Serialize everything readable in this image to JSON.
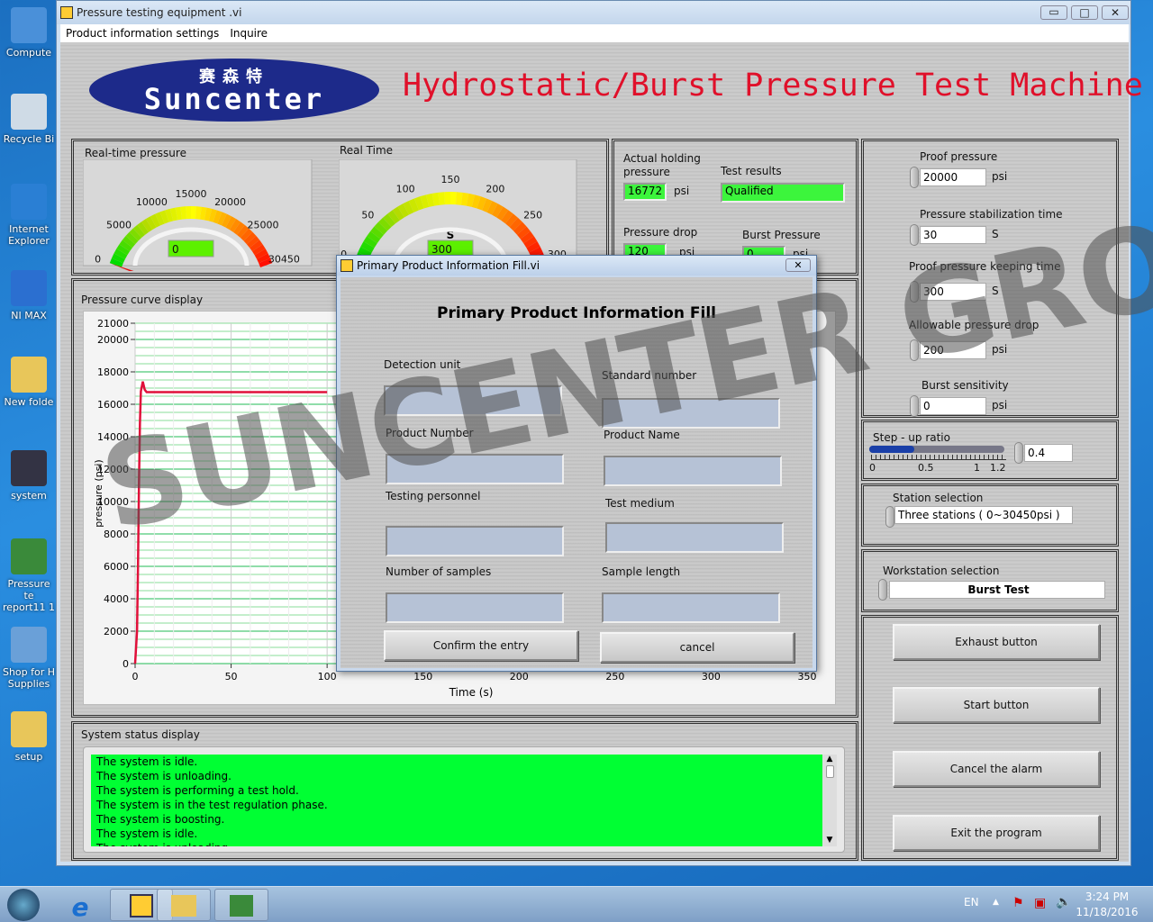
{
  "desktop": {
    "icons": [
      {
        "label": "Compute",
        "icon": "computer-icon",
        "color": "#4a90d9"
      },
      {
        "label": "Recycle Bi",
        "icon": "recycle-bin-icon",
        "color": "#cfdbe6"
      },
      {
        "label": "Internet Explorer",
        "icon": "internet-explorer-icon",
        "color": "#2a7fd4"
      },
      {
        "label": "NI MAX",
        "icon": "ni-max-icon",
        "color": "#2b6fd0"
      },
      {
        "label": "New folde",
        "icon": "folder-icon",
        "color": "#e8c65a"
      },
      {
        "label": "system",
        "icon": "labview-vi-icon",
        "color": "#334"
      },
      {
        "label": "Pressure te report11 1",
        "icon": "excel-file-icon",
        "color": "#3a8a3a"
      },
      {
        "label": "Shop for H Supplies",
        "icon": "printer-icon",
        "color": "#6aa0d8"
      },
      {
        "label": "setup",
        "icon": "folder-icon",
        "color": "#e8c65a"
      }
    ]
  },
  "window": {
    "title": "Pressure testing equipment .vi",
    "menu": [
      "Product information settings",
      "Inquire"
    ]
  },
  "header": {
    "logo_cn": "赛森特",
    "logo_en": "Suncenter",
    "title": "Hydrostatic/Burst Pressure Test Machine",
    "title_color": "#e0102a",
    "logo_color": "#1d2a8a"
  },
  "gauges": {
    "pressure": {
      "label": "Real-time pressure",
      "unit": "psi",
      "ticks": [
        "0",
        "5000",
        "10000",
        "15000",
        "20000",
        "25000",
        "30450"
      ],
      "value": "0",
      "max": 30450
    },
    "time": {
      "label": "Real Time",
      "unit": "S",
      "ticks": [
        "0",
        "50",
        "100",
        "150",
        "200",
        "250",
        "300"
      ],
      "value": "300",
      "max": 300
    }
  },
  "results": {
    "holding_label": "Actual holding pressure",
    "holding_value": "16772",
    "holding_unit": "psi",
    "test_results_label": "Test results",
    "test_results_value": "Qualified",
    "drop_label": "Pressure drop",
    "drop_value": "120",
    "drop_unit": "psi",
    "burst_label": "Burst Pressure",
    "burst_value": "0",
    "burst_unit": "psi"
  },
  "chart_data": {
    "type": "line",
    "title": "Pressure curve display",
    "xlabel": "Time (s)",
    "ylabel": "pressure (psi)",
    "xlim": [
      0,
      350
    ],
    "ylim": [
      0,
      21000
    ],
    "x_ticks": [
      "0",
      "50",
      "100",
      "150",
      "200",
      "250",
      "300",
      "350"
    ],
    "y_ticks": [
      "0",
      "2000",
      "4000",
      "6000",
      "8000",
      "10000",
      "12000",
      "14000",
      "16000",
      "18000",
      "20000",
      "21000"
    ],
    "grid": true,
    "line_color": "#e0103a",
    "x": [
      0,
      1,
      1.5,
      2,
      2.5,
      3,
      4,
      5,
      6,
      50,
      100
    ],
    "y": [
      0,
      2000,
      6000,
      11000,
      14800,
      16800,
      17400,
      16900,
      16750,
      16750,
      16750
    ]
  },
  "settings": {
    "fields": [
      {
        "label": "Proof pressure",
        "value": "20000",
        "unit": "psi"
      },
      {
        "label": "Pressure stabilization time",
        "value": "30",
        "unit": "S"
      },
      {
        "label": "Proof pressure keeping time",
        "value": "300",
        "unit": "S"
      },
      {
        "label": "Allowable pressure drop",
        "value": "200",
        "unit": "psi"
      },
      {
        "label": "Burst sensitivity",
        "value": "0",
        "unit": "psi"
      }
    ],
    "stepup": {
      "label": "Step - up ratio",
      "ticks": [
        "0",
        "0.5",
        "1",
        "1.2"
      ],
      "value": "0.4",
      "fraction": 0.333
    },
    "station": {
      "label": "Station selection",
      "value": "Three stations ( 0~30450psi )"
    },
    "workstation": {
      "label": "Workstation selection",
      "value": "Burst Test"
    },
    "buttons": [
      "Exhaust button",
      "Start  button",
      "Cancel the alarm",
      "Exit the program"
    ]
  },
  "status": {
    "label": "System status display",
    "lines": [
      "The system is idle.",
      "The system is unloading.",
      "The system is performing a test hold.",
      "The system is in the test regulation phase.",
      "The system is boosting.",
      "The system is idle.",
      "The system is unloading."
    ]
  },
  "dialog": {
    "title": "Primary Product Information Fill.vi",
    "heading": "Primary Product Information Fill",
    "fields": [
      "Detection unit",
      "Standard number",
      "Product Number",
      "Product Name",
      "Testing personnel",
      "Test medium",
      "Number of samples",
      "Sample length"
    ],
    "confirm": "Confirm the entry",
    "cancel": "cancel"
  },
  "watermark": "SUNCENTER GROUP",
  "taskbar": {
    "lang": "EN",
    "time": "3:24 PM",
    "date": "11/18/2016"
  }
}
